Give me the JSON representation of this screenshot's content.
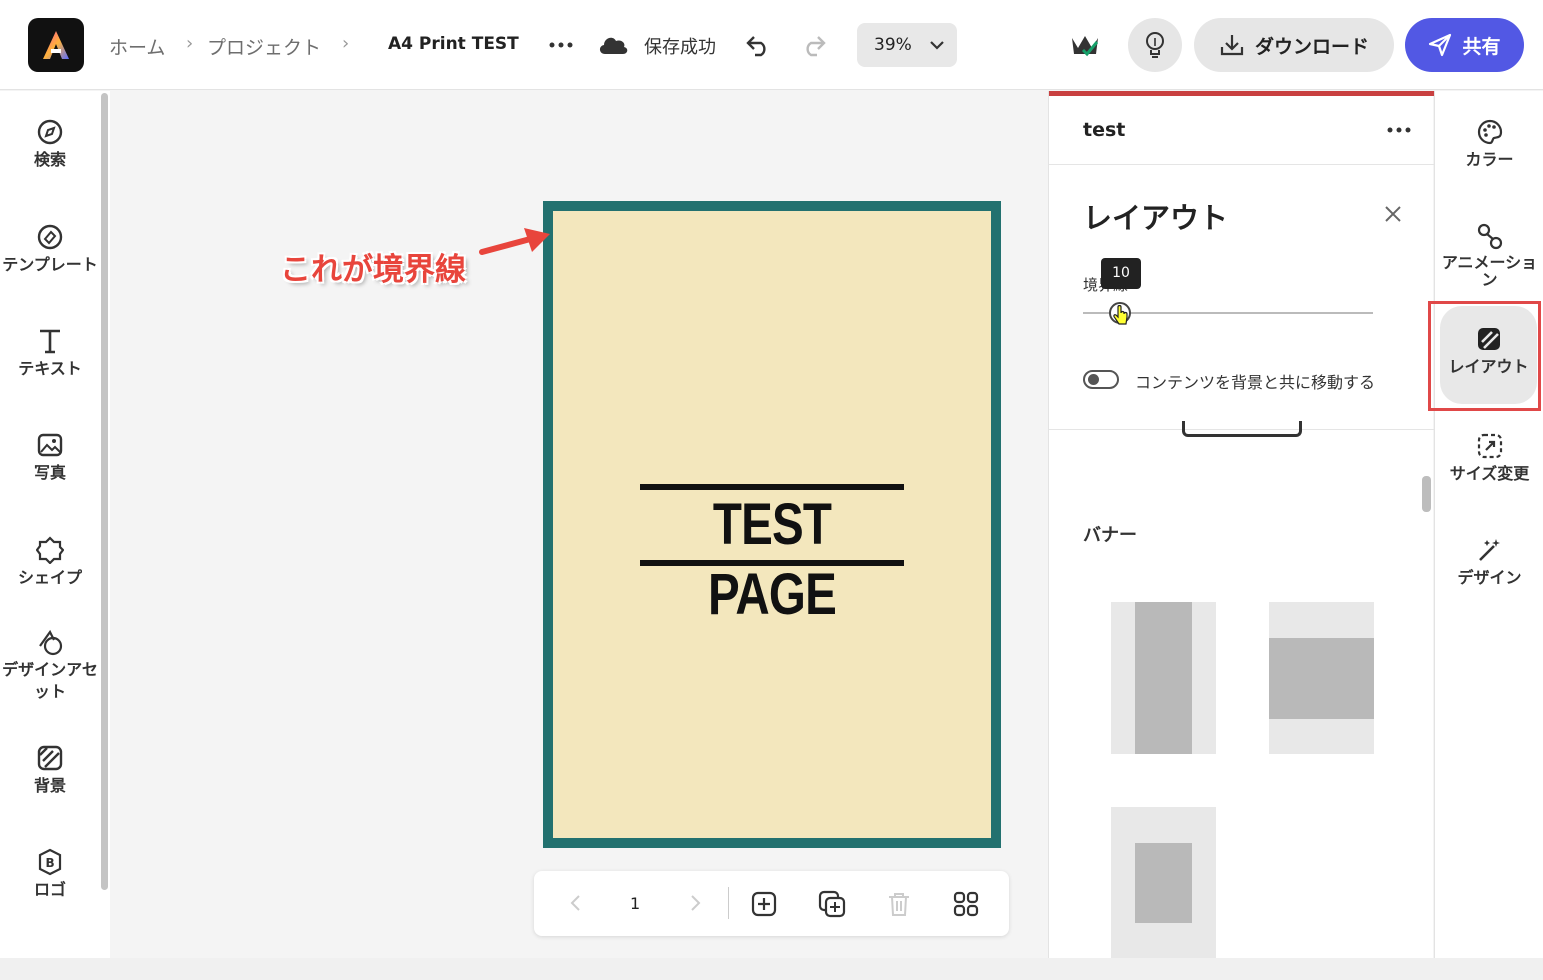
{
  "topbar": {
    "breadcrumb": [
      "ホーム",
      "プロジェクト"
    ],
    "doc_title": "A4 Print TEST",
    "save_status": "保存成功",
    "zoom": "39%",
    "download_label": "ダウンロード",
    "share_label": "共有",
    "colors": {
      "share": "#5258e4"
    }
  },
  "leftnav": {
    "items": [
      {
        "label": "検索",
        "icon": "search-compass-icon"
      },
      {
        "label": "テンプレート",
        "icon": "template-icon"
      },
      {
        "label": "テキスト",
        "icon": "text-icon"
      },
      {
        "label": "写真",
        "icon": "photo-icon"
      },
      {
        "label": "シェイプ",
        "icon": "shape-icon"
      },
      {
        "label": "デザインアセ\nット",
        "icon": "design-assets-icon"
      },
      {
        "label": "背景",
        "icon": "background-icon"
      },
      {
        "label": "ロゴ",
        "icon": "logo-icon"
      }
    ]
  },
  "canvas": {
    "page_text": "TEST PAGE",
    "page_bg": "#f3e7bd",
    "border_color": "#22716f",
    "annotation": "これが境界線",
    "page_number": "1"
  },
  "panel": {
    "title": "test",
    "section_title": "レイアウト",
    "slider_label": "境界線",
    "slider_value": "10",
    "toggle_label": "コンテンツを背景と共に移動する",
    "toggle_on": false,
    "banner_title": "バナー"
  },
  "rightnav": {
    "items": [
      {
        "label": "カラー",
        "icon": "palette-icon"
      },
      {
        "label": "アニメーショ\nン",
        "icon": "animation-icon"
      },
      {
        "label": "レイアウト",
        "icon": "layout-icon"
      },
      {
        "label": "サイズ変更",
        "icon": "resize-icon"
      },
      {
        "label": "デザイン",
        "icon": "magic-wand-icon"
      }
    ]
  }
}
